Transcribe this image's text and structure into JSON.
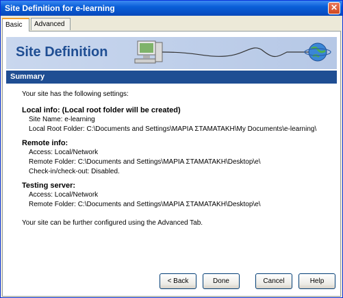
{
  "window": {
    "title": "Site Definition for e-learning",
    "close_glyph": "✕"
  },
  "tabs": [
    {
      "label": "Basic",
      "active": true
    },
    {
      "label": "Advanced",
      "active": false
    }
  ],
  "banner": {
    "title": "Site Definition"
  },
  "summary": {
    "header": "Summary",
    "intro": "Your site has the following settings:",
    "local_heading": "Local info: (Local root folder will be created)",
    "local_site_name": "Site Name: e-learning",
    "local_root_folder": "Local Root Folder: C:\\Documents and Settings\\ΜΑΡΙΑ ΣΤΑΜΑΤΑΚΗ\\My Documents\\e-learning\\",
    "remote_heading": "Remote info:",
    "remote_access": "Access: Local/Network",
    "remote_folder": "Remote Folder: C:\\Documents and Settings\\ΜΑΡΙΑ ΣΤΑΜΑΤΑΚΗ\\Desktop\\e\\",
    "remote_checkin": "Check-in/check-out: Disabled.",
    "testing_heading": "Testing server:",
    "testing_access": "Access: Local/Network",
    "testing_folder": "Remote Folder: C:\\Documents and Settings\\ΜΑΡΙΑ ΣΤΑΜΑΤΑΚΗ\\Desktop\\e\\",
    "footer": "Your site can be further configured using the Advanced Tab."
  },
  "buttons": {
    "back": "< Back",
    "done": "Done",
    "cancel": "Cancel",
    "help": "Help"
  },
  "colors": {
    "titlebar": "#0a5fd8",
    "banner_title": "#1f4e93",
    "summary_bar": "#1f4e93",
    "dialog_bg": "#ece9d8"
  },
  "icons": [
    "computer-icon",
    "network-cable-icon",
    "globe-icon",
    "close-icon"
  ]
}
